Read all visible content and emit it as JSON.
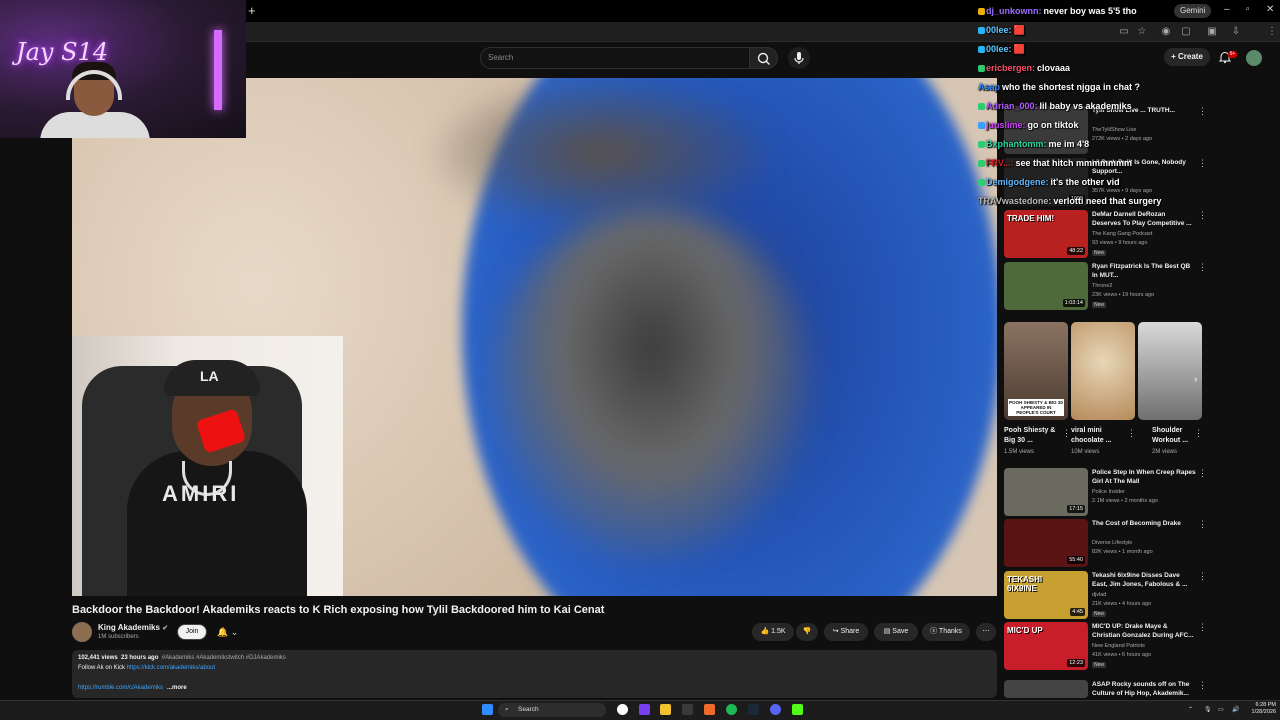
{
  "browser": {
    "new_tab_symbol": "+",
    "gemini_label": "Gemini",
    "window_controls": [
      "–",
      "▫",
      "✕"
    ]
  },
  "youtube": {
    "search_placeholder": "Search",
    "create_label": "Create",
    "notification_count": "9+"
  },
  "video": {
    "title": "Backdoor the Backdoor! Akademiks reacts to K Rich exposing how Tylil Backdoored him to Kai Cenat",
    "inset_shirt_text": "AMIRI",
    "inset_cap_text": "LA"
  },
  "streamer_cam": {
    "neon_sign": "Jay S14"
  },
  "channel": {
    "name": "King Akademiks",
    "subscribers": "1M subscribers",
    "join_label": "Join",
    "bell_glyph": "🔔 ⌄"
  },
  "actions": {
    "like_count": "1.5K",
    "share_label": "Share",
    "save_label": "Save",
    "thanks_label": "Thanks",
    "more_glyph": "⋯"
  },
  "description": {
    "views": "102,441 views",
    "age": "23 hours ago",
    "tags": "#Akademiks #Akademikstwitch #DJAkademiks",
    "follow_text": "Follow Ak on Kick",
    "kick_link": "https://kick.com/akademiks/about",
    "rumble_link": "https://rumble.com/c/Akademiks",
    "more_label": "...more"
  },
  "chat": [
    {
      "user": "dj_unkownn:",
      "text": "never boy was 5'5 tho",
      "color": "#9b6bff"
    },
    {
      "user": "00lee:",
      "text": "🟥",
      "color": "#5ec8ff"
    },
    {
      "user": "00lee:",
      "text": "🟥",
      "color": "#5ec8ff"
    },
    {
      "user": "ericbergen:",
      "text": "clovaaa",
      "color": "#ff4f6a"
    },
    {
      "user": "Asap",
      "text": "who the shortest njgga in chat ?",
      "color": "#2e8bff"
    },
    {
      "user": "Adrian_000:",
      "text": "lil baby vs akademiks",
      "color": "#b05cff"
    },
    {
      "user": "juuslime:",
      "text": "go on tiktok",
      "color": "#d040ff"
    },
    {
      "user": "Bxphantomm:",
      "text": "me im 4'8",
      "color": "#2bd6a0"
    },
    {
      "user": "FRV...:",
      "text": "see that hitch mmmmmmm",
      "color": "#d41f1f"
    },
    {
      "user": "Demigodgene:",
      "text": "it's the other vid",
      "color": "#5fb7ff"
    },
    {
      "user": "TRAVwastedone:",
      "text": "verlotti need that surgery",
      "color": "#bbbbbb"
    }
  ],
  "sidebar": {
    "videos": [
      {
        "title": "Tylil Show Live ... TRUTH...",
        "channel": "TheTylilShow Live",
        "meta": "272K views • 2 days ago",
        "duration": "",
        "new": false,
        "thumb": "#3a3a3a"
      },
      {
        "title": "Lil Durk Built Is Gone, Nobody Support...",
        "channel": "",
        "meta": "357K views • 9 days ago",
        "duration": "1090",
        "new": false,
        "thumb": "#222222"
      },
      {
        "title": "DeMar Darnell DeRozan Deserves To Play Competitive ...",
        "channel": "The Kang Gang Podcast",
        "meta": "93 views • 9 hours ago",
        "duration": "48:22",
        "new": true,
        "thumb": "#b92020",
        "badge": "TRADE HIM!"
      },
      {
        "title": "Ryan Fitzpatrick Is The Best QB In MUT...",
        "channel": "Throne2",
        "meta": "23K views • 19 hours ago",
        "duration": "1:03:14",
        "new": true,
        "thumb": "#4e6a3a"
      },
      {
        "title": "Police Step In When Creep Rapes Girl At The Mall",
        "channel": "Police Insider",
        "meta": "2.1M views • 2 months ago",
        "duration": "17:15",
        "new": false,
        "thumb": "#6a6a5e"
      },
      {
        "title": "The Cost of Becoming Drake",
        "channel": "Diverse Lifestyle",
        "meta": "82K views • 1 month ago",
        "duration": "55:40",
        "new": false,
        "thumb": "#5a1414"
      },
      {
        "title": "Tekashi 6ix9ine Disses Dave East, Jim Jones, Fabolous & ...",
        "channel": "djvlad",
        "meta": "21K views • 4 hours ago",
        "duration": "4:45",
        "new": true,
        "thumb": "#c8a032",
        "badge": "TEKASHI 6IX9INE"
      },
      {
        "title": "MIC'D UP: Drake Maye & Christian Gonzalez During AFC...",
        "channel": "New England Patriots",
        "meta": "41K views • 6 hours ago",
        "duration": "12:23",
        "new": true,
        "thumb": "#c81e2a",
        "badge": "MIC'D UP"
      },
      {
        "title": "ASAP Rocky sounds off on The Culture of Hip Hop, Akademik...",
        "channel": "",
        "meta": "",
        "duration": "",
        "new": false,
        "thumb": "#444444"
      }
    ],
    "new_label": "New",
    "shorts": [
      {
        "title": "Pooh Shiesty & Big 30 ...",
        "views": "1.5M views",
        "thumb": "#6e5a4a",
        "caption": "POOH SHIESTY & BIG 30 APPEARED IN PEOPLE'S COURT"
      },
      {
        "title": "viral mini chocolate ...",
        "views": "10M views",
        "thumb": "#c9a874",
        "caption": ""
      },
      {
        "title": "Shoulder Workout ...",
        "views": "2M views",
        "thumb": "#8a8a8a",
        "caption": ""
      }
    ]
  },
  "taskbar": {
    "search_label": "Search",
    "time": "6:28 PM",
    "date": "1/28/2026"
  }
}
